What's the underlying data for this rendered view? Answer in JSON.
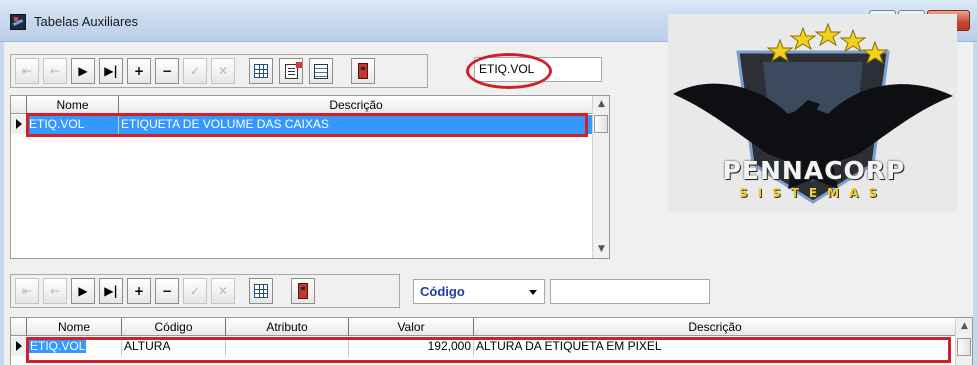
{
  "window": {
    "title": "Tabelas Auxiliares",
    "minimize_glyph": "−",
    "maximize_glyph": "□",
    "close_glyph": "✕"
  },
  "toolbar_top": {
    "search_value": "ETIQ.VOL",
    "icons": {
      "first": "⇤",
      "prior": "←",
      "next": "▶",
      "last": "▶|",
      "insert": "+",
      "delete": "−",
      "post": "✓",
      "cancel": "✕"
    }
  },
  "grid_top": {
    "columns": [
      "Nome",
      "Descrição"
    ],
    "rows": [
      {
        "nome": "ETIQ.VOL",
        "descricao": "ETIQUETA DE VOLUME DAS CAIXAS"
      }
    ]
  },
  "toolbar_bottom": {
    "field_selector_value": "Código",
    "search_value": ""
  },
  "grid_bottom": {
    "columns": [
      "Nome",
      "Código",
      "Atributo",
      "Valor",
      "Descrição"
    ],
    "rows": [
      {
        "nome": "ETIQ.VOL",
        "codigo": "ALTURA",
        "atributo": "",
        "valor": "192,000",
        "descricao": "ALTURA DA ETIQUETA EM PIXEL"
      }
    ]
  },
  "logo": {
    "name": "PENNACORP",
    "subtitle": "SISTEMAS"
  },
  "colors": {
    "selection": "#3399ff",
    "highlight_red": "#d41e2a",
    "title_bar": "#c6d8ee"
  }
}
